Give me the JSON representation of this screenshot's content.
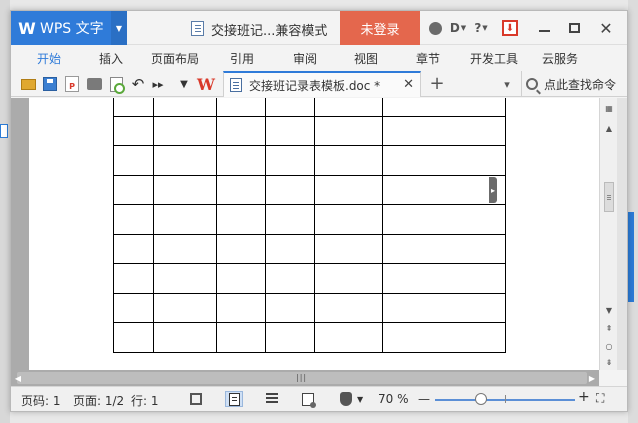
{
  "app": {
    "logo_glyph": "W",
    "name": "WPS 文字",
    "dropdown_glyph": "▼",
    "brand_color": "#2f7bd9"
  },
  "title": {
    "text": "交接班记...兼容模式",
    "login_label": "未登录",
    "login_color": "#e4674d",
    "help_glyph": "?",
    "d_glyph": "D"
  },
  "window_controls": {
    "close_glyph": "✕"
  },
  "menu": {
    "tabs": [
      {
        "label": "开始",
        "active": true
      },
      {
        "label": "插入"
      },
      {
        "label": "页面布局"
      },
      {
        "label": "引用"
      },
      {
        "label": "审阅"
      },
      {
        "label": "视图"
      },
      {
        "label": "章节"
      },
      {
        "label": "开发工具"
      },
      {
        "label": "云服务"
      }
    ]
  },
  "toolbar": {
    "undo_glyph": "↶",
    "more_glyph": "▸▸",
    "drop_glyph": "▼",
    "wps_glyph": "W",
    "pdf_glyph": "P",
    "arrange_glyph": "▾",
    "icons": [
      "open-folder-icon",
      "save-icon",
      "export-pdf-icon",
      "print-icon",
      "print-preview-icon",
      "undo-icon",
      "more-icon",
      "dropdown-arrow-icon",
      "wps-logo-icon"
    ]
  },
  "doc_tab": {
    "label": "交接班记录表模板.doc *",
    "close_glyph": "✕",
    "new_tab_glyph": "+"
  },
  "search": {
    "label": "点此查找命令"
  },
  "document": {
    "table_columns": 6,
    "table_rows": 9,
    "collapse_glyph": "▸"
  },
  "scrollbar": {
    "up_glyph": "▲",
    "down_glyph": "▼",
    "prev_page_glyph": "⇞",
    "select_browse_glyph": "○",
    "next_page_glyph": "⇟",
    "top_glyph": "▦",
    "left_glyph": "◀",
    "right_glyph": "▶",
    "grip_glyph": "|||"
  },
  "status": {
    "page_number": "页码: 1",
    "pages": "页面: 1/2",
    "line": "行: 1",
    "zoom": "70 %",
    "zoom_minus": "—",
    "zoom_plus": "+",
    "fullscreen_glyph": "⛶"
  }
}
